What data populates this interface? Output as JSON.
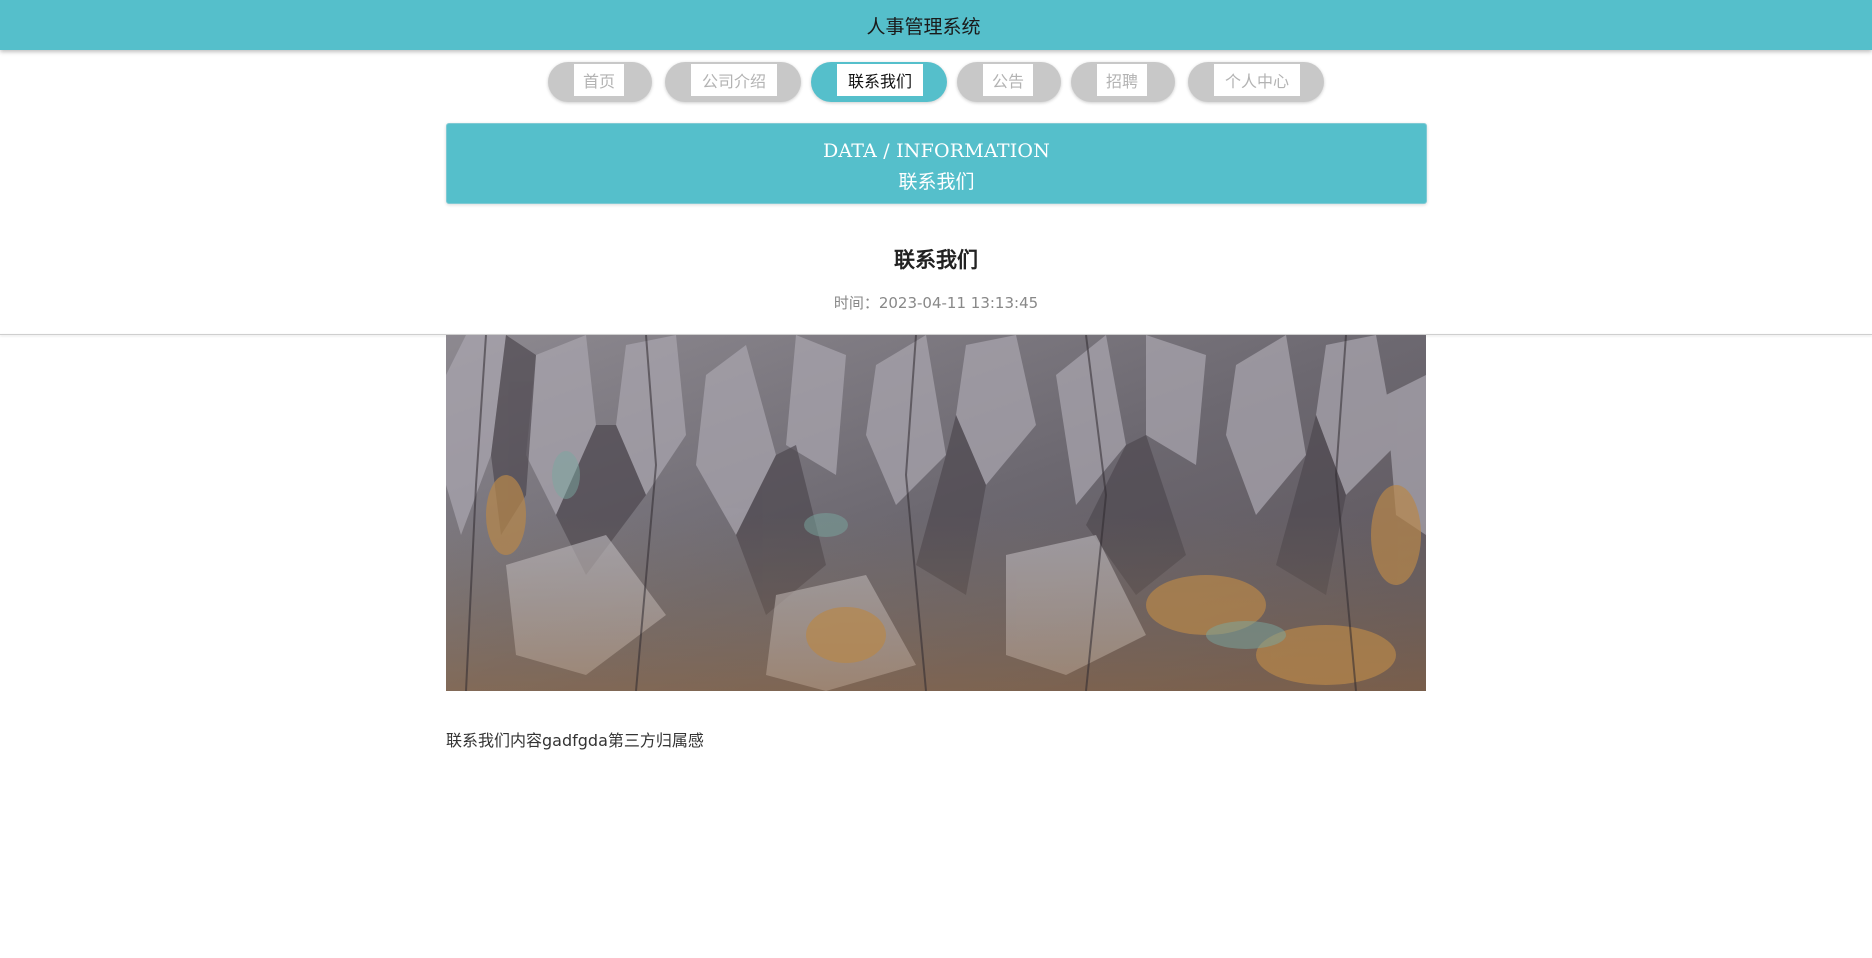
{
  "header": {
    "title": "人事管理系统"
  },
  "nav": {
    "items": [
      {
        "label": "首页",
        "active": false
      },
      {
        "label": "公司介绍",
        "active": false
      },
      {
        "label": "联系我们",
        "active": true
      },
      {
        "label": "公告",
        "active": false
      },
      {
        "label": "招聘",
        "active": false
      },
      {
        "label": "个人中心",
        "active": false
      }
    ]
  },
  "banner": {
    "en": "DATA / INFORMATION",
    "cn": "联系我们"
  },
  "article": {
    "title": "联系我们",
    "meta": "时间：2023-04-11 13:13:45",
    "image_subject": "rock-cliff-texture-photo",
    "body": "联系我们内容gadfgda第三方归属感"
  },
  "colors": {
    "accent": "#55bfcb",
    "nav_inactive": "#c8c8c8"
  }
}
